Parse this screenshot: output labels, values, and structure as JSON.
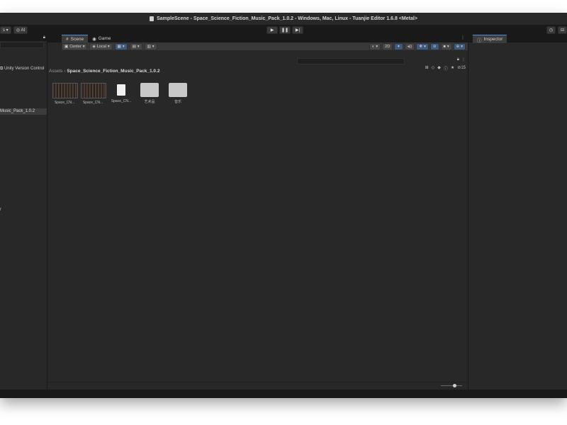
{
  "window": {
    "title": "SampleScene - Space_Science_Fiction_Music_Pack_1.0.2 - Windows, Mac, Linux - Tuanjie Editor 1.6.8 <Metal>"
  },
  "toolbar": {
    "left_dropdown": "s ▾",
    "ai_label": "AI",
    "play_icon": "▶",
    "pause_icon": "❚❚",
    "step_icon": "▶|"
  },
  "hierarchy": {
    "item_label": "Music_Pack_1.0.2",
    "version_control_label": "Unity Version Control",
    "side_text": "r"
  },
  "scene_view": {
    "tabs": [
      {
        "label": "Scene"
      },
      {
        "label": "Game"
      }
    ],
    "pivot_label": "Center",
    "space_label": "Local",
    "mode_2d": "2D"
  },
  "project": {
    "hidden_count": "15",
    "breadcrumb_root": "Assets",
    "breadcrumb_current": "Space_Science_Fiction_Music_Pack_1.0.2",
    "assets": [
      {
        "label": "Space_CN...",
        "kind": "audio"
      },
      {
        "label": "Space_CN...",
        "kind": "audio"
      },
      {
        "label": "Space_CN...",
        "kind": "file"
      },
      {
        "label": "艺术品",
        "kind": "folder"
      },
      {
        "label": "音乐",
        "kind": "folder"
      }
    ]
  },
  "inspector": {
    "tab_label": "Inspector"
  },
  "colors": {
    "accent": "#4a90d9",
    "panel": "#282828",
    "chrome": "#191919"
  }
}
